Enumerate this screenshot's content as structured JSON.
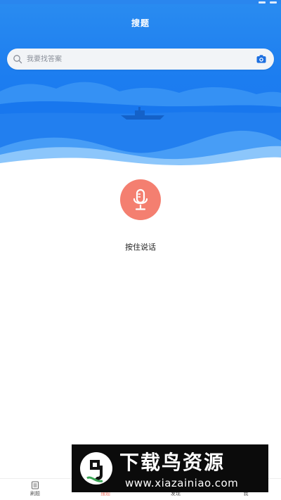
{
  "header": {
    "title": "搜题"
  },
  "search": {
    "placeholder": "我要找答案",
    "icon": "search-icon",
    "camera_icon": "camera-icon"
  },
  "voice": {
    "label": "按住说话",
    "icon": "microphone-icon",
    "color": "#f47f70"
  },
  "tabs": [
    {
      "label": "刷题",
      "icon": "list-icon"
    },
    {
      "label": "搜题",
      "icon": "search-icon",
      "active": true
    },
    {
      "label": "发现",
      "icon": "compass-icon"
    },
    {
      "label": "我",
      "icon": "user-icon"
    }
  ],
  "watermark": {
    "title": "下载鸟资源",
    "url": "www.xiazainiao.com"
  },
  "colors": {
    "header_blue": "#1c7df0",
    "accent": "#f47f70"
  }
}
